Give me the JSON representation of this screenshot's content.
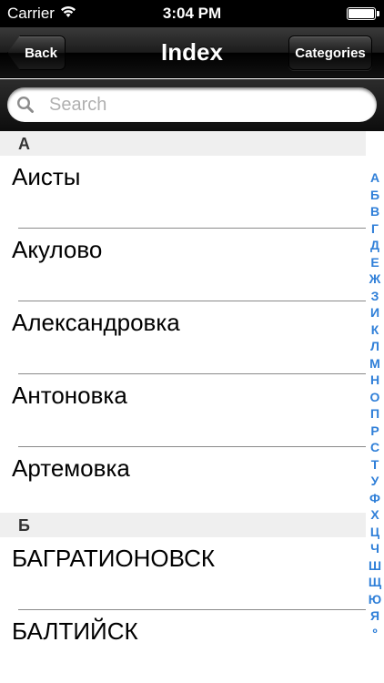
{
  "status_bar": {
    "carrier": "Carrier",
    "time": "3:04 PM"
  },
  "nav": {
    "title": "Index",
    "back_label": "Back",
    "categories_label": "Categories"
  },
  "search": {
    "placeholder": "Search",
    "value": ""
  },
  "sections": [
    {
      "header": "А",
      "items": [
        "Аисты",
        "Акулово",
        "Александровка",
        "Антоновка",
        "Артемовка"
      ]
    },
    {
      "header": "Б",
      "items": [
        "БАГРАТИОНОВСК",
        "БАЛТИЙСК"
      ]
    }
  ],
  "index_letters": [
    "А",
    "Б",
    "В",
    "Г",
    "Д",
    "Е",
    "Ж",
    "З",
    "И",
    "К",
    "Л",
    "М",
    "Н",
    "О",
    "П",
    "Р",
    "С",
    "Т",
    "У",
    "Ф",
    "Х",
    "Ц",
    "Ч",
    "Ш",
    "Щ",
    "Ю",
    "Я",
    "º"
  ],
  "colors": {
    "index_accent": "#2f7fd8",
    "nav_background": "#1c1c1c",
    "section_header_bg": "#efefef"
  },
  "icons": {
    "search": "search-icon",
    "wifi": "wifi-icon",
    "battery": "battery-icon"
  }
}
